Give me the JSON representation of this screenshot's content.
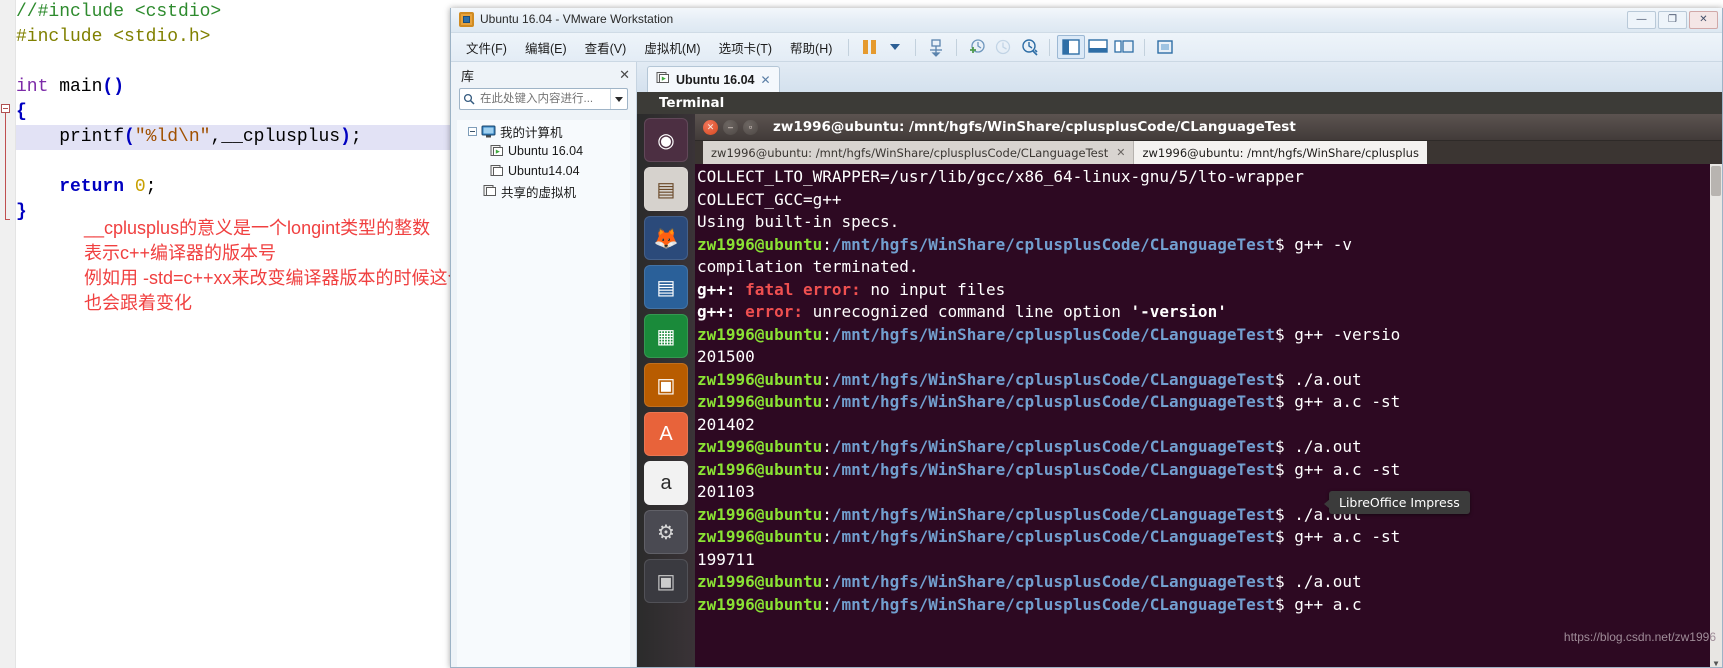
{
  "editor": {
    "code_lines": [
      {
        "parts": [
          {
            "t": "//#include <cstdio>",
            "c": "c-comment"
          }
        ]
      },
      {
        "parts": [
          {
            "t": "#include <stdio.h>",
            "c": "c-pre"
          }
        ]
      },
      {
        "parts": [
          {
            "t": "",
            "c": "c-plain"
          }
        ]
      },
      {
        "parts": [
          {
            "t": "int",
            "c": "c-kw"
          },
          {
            "t": " main",
            "c": "c-fn"
          },
          {
            "t": "()",
            "c": "c-br"
          }
        ]
      },
      {
        "parts": [
          {
            "t": "{",
            "c": "c-br"
          }
        ]
      },
      {
        "parts": [
          {
            "t": "    printf",
            "c": "c-fn"
          },
          {
            "t": "(",
            "c": "c-br"
          },
          {
            "t": "\"%ld\\n\"",
            "c": "c-str"
          },
          {
            "t": ",__cplusplus",
            "c": "c-id"
          },
          {
            "t": ")",
            "c": "c-br"
          },
          {
            "t": ";",
            "c": "c-plain"
          }
        ],
        "highlight": true
      },
      {
        "parts": [
          {
            "t": "",
            "c": "c-plain"
          }
        ]
      },
      {
        "parts": [
          {
            "t": "    return",
            "c": "c-kw2"
          },
          {
            "t": " 0",
            "c": "c-num"
          },
          {
            "t": ";",
            "c": "c-plain"
          }
        ]
      },
      {
        "parts": [
          {
            "t": "}",
            "c": "c-br"
          }
        ]
      }
    ],
    "annotation_lines": [
      "__cplusplus的意义是一个longint类型的整数",
      "表示c++编译器的版本号",
      "例如用 -std=c++xx来改变编译器版本的时候这个值",
      "也会跟着变化"
    ],
    "annotation_color": "#f04040"
  },
  "vmware": {
    "title": "Ubuntu 16.04 - VMware Workstation",
    "window_buttons": [
      {
        "name": "minimize",
        "glyph": "—"
      },
      {
        "name": "maximize",
        "glyph": "❐"
      },
      {
        "name": "close",
        "glyph": "✕"
      }
    ],
    "menu_items": [
      "文件(F)",
      "编辑(E)",
      "查看(V)",
      "虚拟机(M)",
      "选项卡(T)",
      "帮助(H)"
    ],
    "toolbar_icons": [
      "pause-icon",
      "dropdown-caret-icon",
      "snapshot-manager-icon",
      "take-snapshot-icon",
      "revert-snapshot-icon",
      "manage-snapshots-icon",
      "show-library-icon",
      "show-console-view-icon",
      "show-thumbnails-icon",
      "fullscreen-icon"
    ],
    "library": {
      "header": "库",
      "search_placeholder": "在此处键入内容进行...",
      "search_value": "",
      "tree": [
        {
          "label": "我的计算机",
          "icon": "computer-icon",
          "level": 0,
          "expander": true
        },
        {
          "label": "Ubuntu 16.04",
          "icon": "vm-running-icon",
          "level": 1
        },
        {
          "label": "Ubuntu14.04",
          "icon": "vm-icon",
          "level": 1
        },
        {
          "label": "共享的虚拟机",
          "icon": "shared-vm-icon",
          "level": 0
        }
      ]
    },
    "tabs": [
      {
        "label": "Ubuntu 16.04",
        "icon": "vm-running-icon",
        "active": true,
        "close": "✕"
      }
    ]
  },
  "guest": {
    "unity_top_title": "Terminal",
    "launcher_icons": [
      {
        "name": "ubuntu-dash-icon",
        "bg": "#4c2f42",
        "glyph": "◉",
        "color": "#ffffff"
      },
      {
        "name": "files-nautilus-icon",
        "bg": "#d6d2cd",
        "glyph": "▤",
        "color": "#6b4a2a"
      },
      {
        "name": "firefox-icon",
        "bg": "#2b4a7a",
        "glyph": "🦊",
        "color": "#ff9500"
      },
      {
        "name": "libreoffice-writer-icon",
        "bg": "#2a6099",
        "glyph": "▤",
        "color": "#ffffff"
      },
      {
        "name": "libreoffice-calc-icon",
        "bg": "#1a8a3a",
        "glyph": "▦",
        "color": "#ffffff"
      },
      {
        "name": "libreoffice-impress-icon",
        "bg": "#b85c00",
        "glyph": "▣",
        "color": "#ffffff"
      },
      {
        "name": "ubuntu-software-icon",
        "bg": "#e8633a",
        "glyph": "A",
        "color": "#ffffff"
      },
      {
        "name": "amazon-icon",
        "bg": "#f2f2f2",
        "glyph": "a",
        "color": "#2a2a2a"
      },
      {
        "name": "system-settings-icon",
        "bg": "#4a4a52",
        "glyph": "⚙",
        "color": "#d8d8d8"
      },
      {
        "name": "workspace-switcher-icon",
        "bg": "#3a3a40",
        "glyph": "▣",
        "color": "#cccccc"
      }
    ],
    "tooltip": "LibreOffice Impress",
    "terminal": {
      "window_title": "zw1996@ubuntu: /mnt/hgfs/WinShare/cplusplusCode/CLanguageTest",
      "titlebar_buttons": [
        {
          "name": "close-button",
          "glyph": "✕"
        },
        {
          "name": "minimize-button",
          "glyph": "–"
        },
        {
          "name": "maximize-button",
          "glyph": "▫"
        }
      ],
      "tabs": [
        {
          "label": "zw1996@ubuntu: /mnt/hgfs/WinShare/cplusplusCode/CLanguageTest",
          "close": "✕",
          "active": false
        },
        {
          "label": "zw1996@ubuntu: /mnt/hgfs/WinShare/cplusplus",
          "close": "",
          "active": true
        }
      ],
      "prompt_user": "zw1996@ubuntu",
      "prompt_colon": ":",
      "prompt_path": "/mnt/hgfs/WinShare/cplusplusCode/CLanguageTest",
      "prompt_dollar": "$",
      "lines": [
        {
          "type": "prompt",
          "cmd": " g++ a.c"
        },
        {
          "type": "prompt",
          "cmd": " ./a.out"
        },
        {
          "type": "out",
          "text": "199711"
        },
        {
          "type": "prompt",
          "cmd": " g++ a.c -st"
        },
        {
          "type": "prompt",
          "cmd": " ./a.out"
        },
        {
          "type": "out",
          "text": "201103"
        },
        {
          "type": "prompt",
          "cmd": " g++ a.c -st"
        },
        {
          "type": "prompt",
          "cmd": " ./a.out"
        },
        {
          "type": "out",
          "text": "201402"
        },
        {
          "type": "prompt",
          "cmd": " g++ a.c -st"
        },
        {
          "type": "prompt",
          "cmd": " ./a.out"
        },
        {
          "type": "out",
          "text": "201500"
        },
        {
          "type": "prompt",
          "cmd": " g++ -versio"
        },
        {
          "type": "err",
          "pre": "g++: ",
          "em": "error: ",
          "rest": "unrecognized command line option ",
          "opt": "'-version'"
        },
        {
          "type": "err",
          "pre": "g++: ",
          "em": "fatal error: ",
          "rest": "no input files",
          "opt": ""
        },
        {
          "type": "out",
          "text": "compilation terminated."
        },
        {
          "type": "prompt",
          "cmd": " g++ -v"
        },
        {
          "type": "out",
          "text": "Using built-in specs."
        },
        {
          "type": "out",
          "text": "COLLECT_GCC=g++"
        },
        {
          "type": "out",
          "text": "COLLECT_LTO_WRAPPER=/usr/lib/gcc/x86_64-linux-gnu/5/lto-wrapper"
        }
      ]
    }
  },
  "watermark": "https://blog.csdn.net/zw1996"
}
